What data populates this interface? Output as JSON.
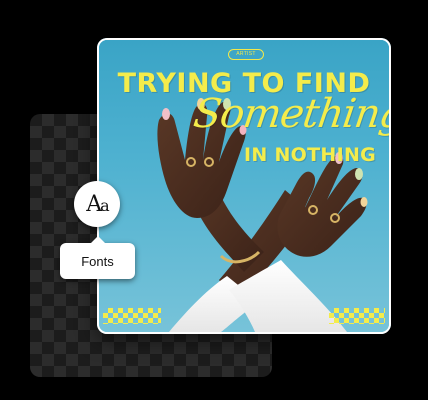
{
  "poster": {
    "pill_text": "ARTIST",
    "title_line_1": "TRYING TO FIND",
    "title_line_2": "Something",
    "title_line_3": "IN NOTHING",
    "accent_color": "#f4ec4b",
    "sky_color": "#4bb0cf"
  },
  "tool": {
    "icon": "font-icon",
    "icon_glyph_big": "A",
    "icon_glyph_small": "a",
    "label": "Fonts"
  },
  "canvas": {
    "background": "transparent-checkerboard"
  }
}
